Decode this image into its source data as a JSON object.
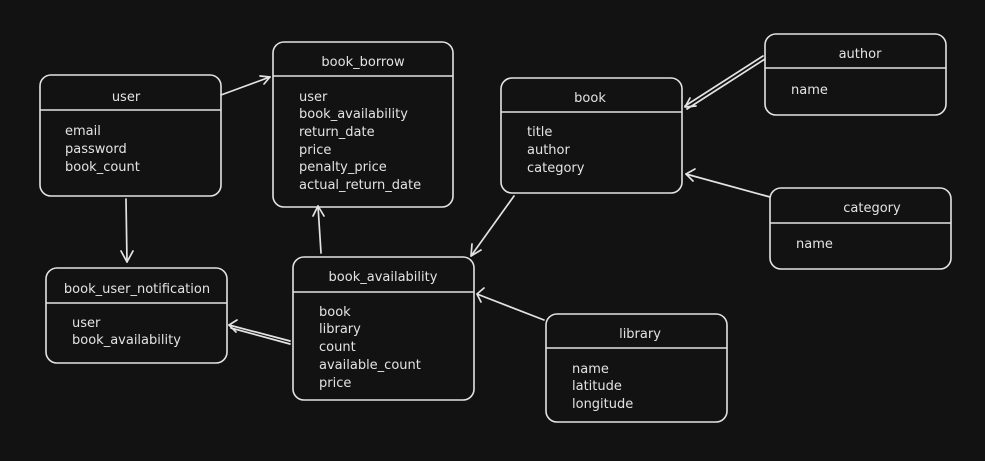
{
  "entities": {
    "user": {
      "title": "user",
      "fields": [
        "email",
        "password",
        "book_count"
      ]
    },
    "book_borrow": {
      "title": "book_borrow",
      "fields": [
        "user",
        "book_availability",
        "return_date",
        "price",
        "penalty_price",
        "actual_return_date"
      ]
    },
    "book": {
      "title": "book",
      "fields": [
        "title",
        "author",
        "category"
      ]
    },
    "author": {
      "title": "author",
      "fields": [
        "name"
      ]
    },
    "category": {
      "title": "category",
      "fields": [
        "name"
      ]
    },
    "book_user_notification": {
      "title": "book_user_notification",
      "fields": [
        "user",
        "book_availability"
      ]
    },
    "book_availability": {
      "title": "book_availability",
      "fields": [
        "book",
        "library",
        "count",
        "available_count",
        "price"
      ]
    },
    "library": {
      "title": "library",
      "fields": [
        "name",
        "latitude",
        "longitude"
      ]
    }
  },
  "colors": {
    "background": "#121212",
    "stroke": "#e3e3e3"
  }
}
